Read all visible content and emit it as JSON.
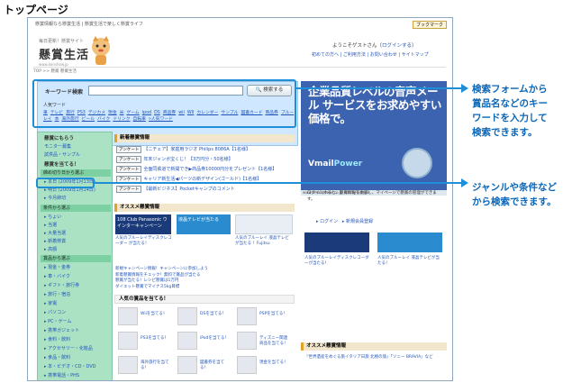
{
  "page_title": "トップページ",
  "site": {
    "top_strip": "懸賞情報なら懸賞生活 | 懸賞生活で楽しく懸賞ライフ",
    "bookmark": "ブックマーク",
    "logo_sub": "毎日更新！懸賞サイト",
    "logo": "懸賞生活",
    "logo_url": "www.kenshow.jp",
    "welcome_prefix": "ようこそゲストさん（",
    "login_link": "ログインする",
    "welcome_suffix": "）",
    "top_links": "初めての方へ | ご利用方法 | お問い合わせ | サイトマップ",
    "breadcrumb": "TOP >> 懸賞 懸賞生活"
  },
  "search": {
    "label": "キーワード検索",
    "input_value": "",
    "button": "検索する",
    "popular_label": "人気ワード",
    "popular_words": [
      "車",
      "テレビ",
      "旅行",
      "PS3",
      "デジカメ",
      "現金",
      "米",
      "ゲーム",
      "ipod",
      "DS",
      "商品券",
      "wii",
      "WII",
      "カレンダー",
      "サンプル",
      "図書カード",
      "商品券",
      "ブルーレイ",
      "本",
      "海外旅行",
      "ビール",
      "バイク",
      "ドリンク",
      "自転車"
    ],
    "more_link": "»人気ワード"
  },
  "ad": {
    "text": "企業品質レベルの音声メール サービスをお求めやすい価格で。",
    "brand_prefix": "Vmail",
    "brand_suffix": "Power",
    "url": "www.vmailpower.co.jp     Ads by Google"
  },
  "sidebar": {
    "head1": "懸賞にもらう",
    "head1_items": [
      "モニター募集",
      "試供品・サンプル"
    ],
    "head2": "懸賞を当てる！",
    "deadline_section": "締め切り日から選ぶ",
    "deadline_items": [
      "本日 (2009年1月13日)",
      "明日 (2009年1月14日)",
      "今月締切"
    ],
    "condition_section": "条件から選ぶ",
    "condition_items": [
      "ちょい",
      "当選",
      "大量当選",
      "新着懸賞",
      "高額"
    ],
    "product_section": "賞品から選ぶ",
    "product_items": [
      "現金・金券",
      "車・バイク",
      "ギフト・旅行券",
      "旅行・宿泊",
      "家電",
      "パソコン",
      "PC・ゲーム",
      "携帯ガジェット",
      "食料・飲料",
      "アクセサリー・化粧品",
      "食品・飲料",
      "本・ビデオ・CD・DVD",
      "携帯電話・PHS"
    ]
  },
  "news": {
    "title": "新着懸賞情報",
    "tag": "アンケート",
    "items": [
      "【ニチェア】家庭用ラジオ Philips 8086A【1名様】",
      "年末ジャンボ宝くじ！【3万円分・50名様】",
      "全面同鉄道で新開でき▶商品券10000円分をプレゼント【1名様】",
      "キャリア新生活◀パーツの新デザイン(ゴールド)【1名様】",
      "【最新ビジネス】Pocketキャンプのコメント"
    ]
  },
  "osusume": {
    "title": "オススメ懸賞情報",
    "promo1": "108 Club Panasonic ウインターキャンペーン",
    "promo1_caption": "人気のブルーレイディスクレコーダー が当たる！",
    "promo2": "液晶テレビが当たる",
    "promo2_caption": "人気のブルーレイ 液晶テレビが当たる ！Fujitsu",
    "download_links": [
      "新規キャンペーン情報！キャンペーンに参加しよう",
      "新着懸賞情報をチェック！無料で賞品が当たる",
      "懸賞が当たる！レシピ懸賞は1万円",
      "ダイエット懸賞でマイナス5kg目標"
    ]
  },
  "present": {
    "head": "人気の賞品を当てる！",
    "items": [
      "Wiiを当てる！",
      "DSを当てる！",
      "PSPを当てる！",
      "PS3を当てる！",
      "iPodを当てる！",
      "ディズニー関連商品を当てる！",
      "海外旅行を当てる！",
      "図書券を当てる！",
      "現金を当てる！"
    ]
  },
  "right_column": {
    "intro": "ログインすると、懸賞情報を更新し、マイページで懸賞の管理ができます。",
    "login": "ログイン",
    "register": "新規会員登録",
    "promo_caption1": "人気のブルーレイディスクレコーダーが当たる！",
    "promo_caption2": "人気のブルーレイ 液晶テレビが当たる！",
    "osusume_title": "オススメ懸賞情報",
    "bottom_item": "『世界遺産をめぐる旅イタリア日旅 北極の旅』「ソニー BRAVIA」など"
  },
  "callouts": {
    "search": "検索フォームから\n賞品名などのキー\nワードを入力して\n検索できます。",
    "genre": "ジャンルや条件など\nから検索できます。"
  },
  "colors": {
    "highlight_green": "#abe2c4",
    "callout_blue": "#1e8fd6",
    "search_bg": "#cfe7ff",
    "ad_blue": "#3c63b0"
  }
}
